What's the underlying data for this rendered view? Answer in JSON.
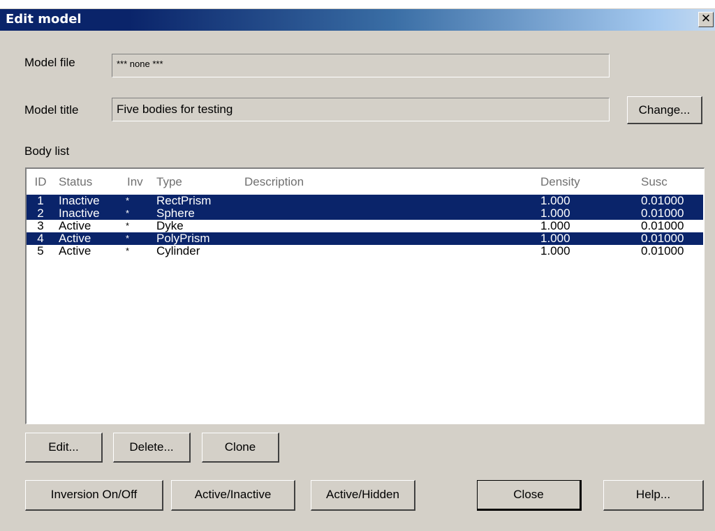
{
  "window": {
    "title": "Edit model",
    "close_glyph": "✕"
  },
  "model_file": {
    "label": "Model file",
    "value": "*** none ***"
  },
  "model_title": {
    "label": "Model title",
    "value": "Five bodies for testing",
    "change_label": "Change..."
  },
  "body_list": {
    "label": "Body list",
    "columns": [
      "ID",
      "Status",
      "Inv",
      "Type",
      "Description",
      "Density",
      "Susc"
    ],
    "rows": [
      {
        "id": "1",
        "status": "Inactive",
        "inv": "*",
        "type": "RectPrism",
        "description": "",
        "density": "1.000",
        "susc": "0.01000",
        "selected": true
      },
      {
        "id": "2",
        "status": "Inactive",
        "inv": "*",
        "type": "Sphere",
        "description": "",
        "density": "1.000",
        "susc": "0.01000",
        "selected": true
      },
      {
        "id": "3",
        "status": "Active",
        "inv": "*",
        "type": "Dyke",
        "description": "",
        "density": "1.000",
        "susc": "0.01000",
        "selected": false
      },
      {
        "id": "4",
        "status": "Active",
        "inv": "*",
        "type": "PolyPrism",
        "description": "",
        "density": "1.000",
        "susc": "0.01000",
        "selected": true
      },
      {
        "id": "5",
        "status": "Active",
        "inv": "*",
        "type": "Cylinder",
        "description": "",
        "density": "1.000",
        "susc": "0.01000",
        "selected": false
      }
    ]
  },
  "buttons": {
    "edit": "Edit...",
    "delete": "Delete...",
    "clone": "Clone",
    "inversion": "Inversion On/Off",
    "active_inactive": "Active/Inactive",
    "active_hidden": "Active/Hidden",
    "close": "Close",
    "help": "Help..."
  },
  "colors": {
    "selection": "#0a246a",
    "dialog_bg": "#d4d0c8",
    "title_gradient_start": "#0a246a",
    "title_gradient_end": "#a6caf0"
  }
}
